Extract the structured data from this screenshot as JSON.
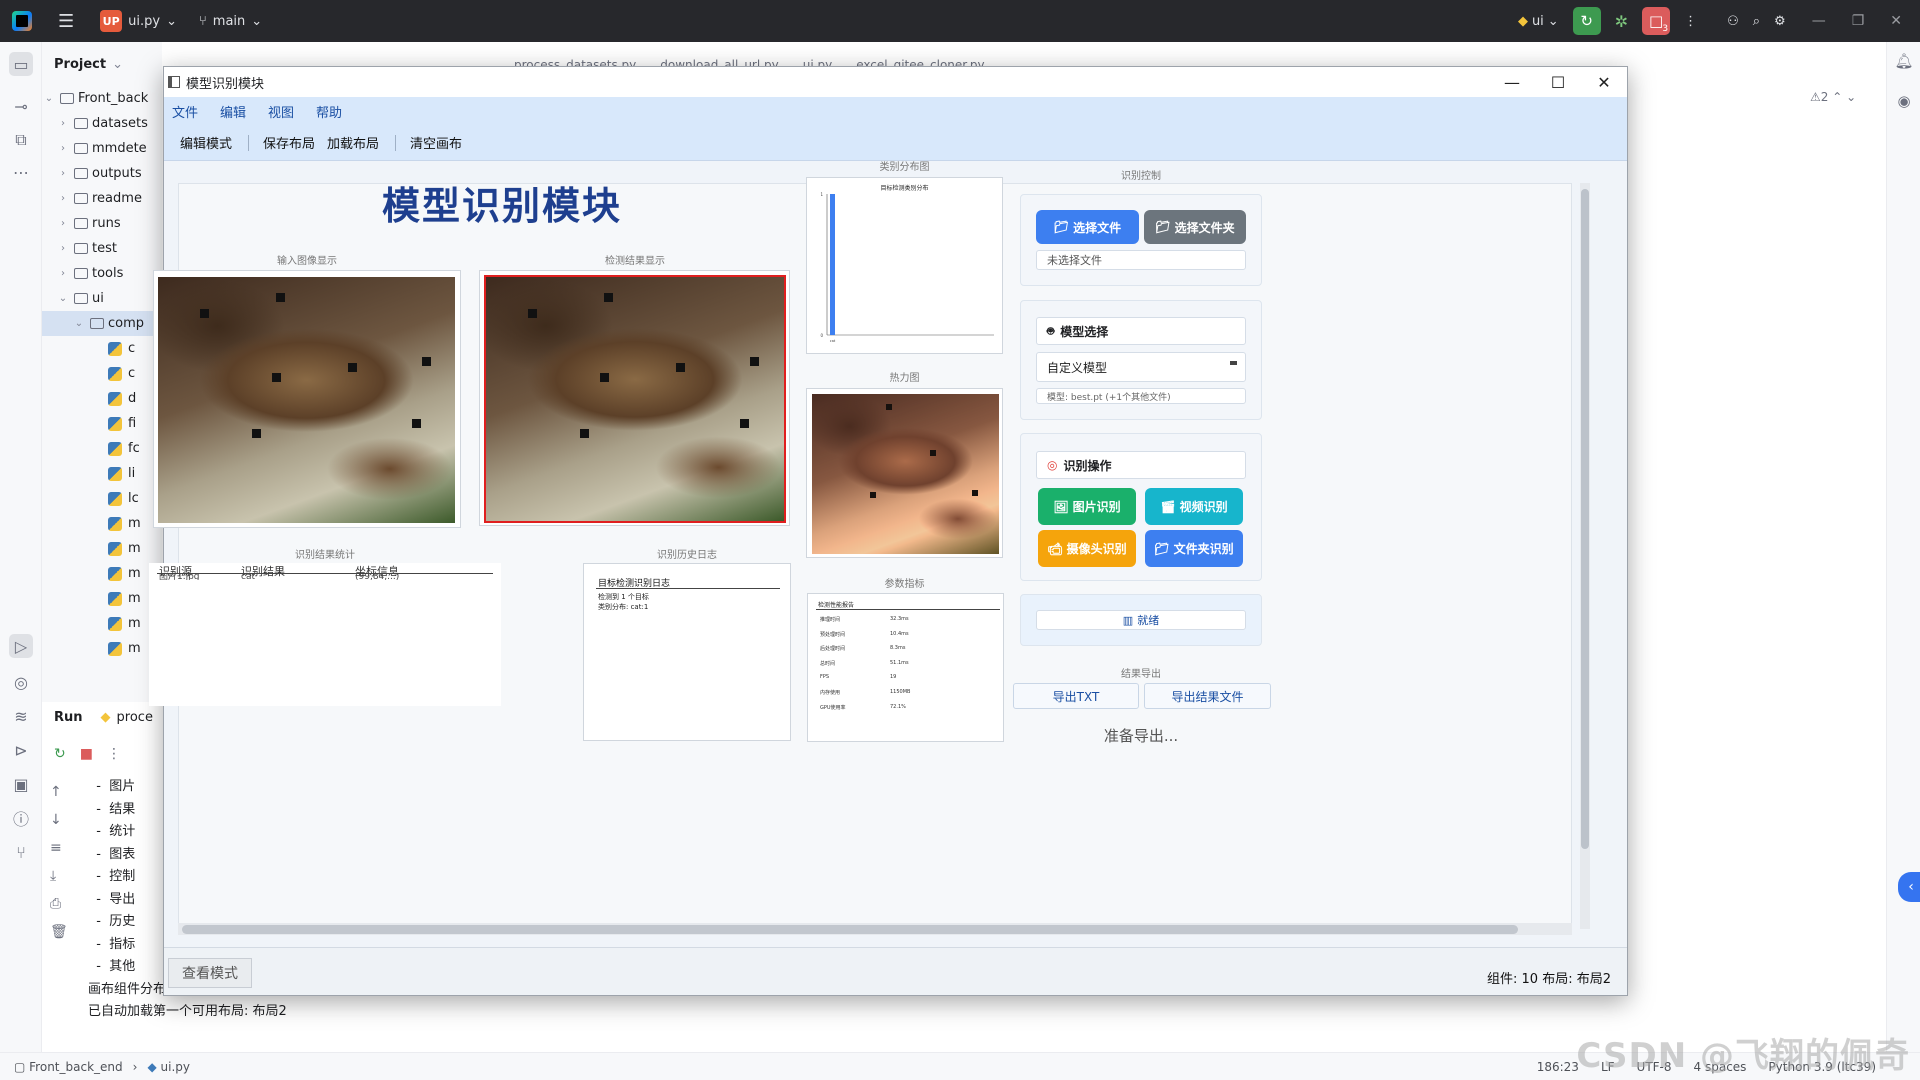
{
  "ide": {
    "project_badge": "UP",
    "project_name": "ui.py",
    "branch": "main",
    "venv": "ui",
    "project_label": "Project",
    "tree": [
      "Front_back",
      "datasets",
      "mmdete",
      "outputs",
      "readme",
      "runs",
      "test",
      "tools",
      "ui",
      "comp"
    ],
    "tree_files": [
      "c",
      "c",
      "d",
      "fi",
      "fc",
      "li",
      "lc",
      "m",
      "m",
      "m",
      "m",
      "m",
      "m"
    ],
    "editor_tabs": [
      "process_datasets.py",
      "download_all_url.py",
      "ui.py",
      "excel_gitee_cloner.py"
    ],
    "problems_count": "2",
    "run_label": "Run",
    "run_tab": "proce",
    "console_lines": [
      "  -  图片",
      "  -  结果",
      "  -  统计",
      "  -  图表",
      "  -  控制",
      "  -  导出",
      "  -  历史",
      "  -  指标",
      "  -  其他",
      "画布组件分布完成",
      "已自动加载第一个可用布局: 布局2"
    ],
    "breadcrumb": [
      "Front_back_end",
      "ui.py"
    ],
    "status": {
      "position": "186:23",
      "line_sep": "LF",
      "encoding": "UTF-8",
      "indent": "4 spaces",
      "interpreter": "Python 3.9 (ltc39)"
    },
    "watermark": "CSDN @飞翔的佩奇"
  },
  "app": {
    "window_title": "模型识别模块",
    "menu": [
      "文件",
      "编辑",
      "视图",
      "帮助"
    ],
    "toolbar": [
      "编辑模式",
      "保存布局",
      "加载布局",
      "清空画布"
    ],
    "main_title": "模型识别模块",
    "captions": {
      "input_image": "输入图像显示",
      "result_image": "检测结果显示",
      "stats": "识别结果统计",
      "history": "识别历史日志",
      "class_chart": "类别分布图",
      "heatmap": "热力图",
      "metrics": "参数指标",
      "control": "识别控制",
      "export": "结果导出"
    },
    "stats_table": {
      "headers": [
        "识别源",
        "识别结果",
        "坐标信息"
      ],
      "row": [
        "图片1.jpg",
        "cat",
        "(99,84,...)"
      ]
    },
    "history_log": {
      "title": "目标检测识别日志",
      "lines": [
        "检测到 1 个目标",
        "类别分布: cat:1"
      ]
    },
    "chart_title": "目标检测类别分布",
    "metrics_title": "检测性能报告",
    "metric_rows": [
      [
        "推理时间",
        "32.3ms"
      ],
      [
        "预处理时间",
        "10.4ms"
      ],
      [
        "后处理时间",
        "8.3ms"
      ],
      [
        "总时间",
        "51.1ms"
      ],
      [
        "FPS",
        "19"
      ],
      [
        "内存使用",
        "1150MB"
      ],
      [
        "GPU使用率",
        "72.1%"
      ]
    ],
    "buttons": {
      "select_file": "选择文件",
      "select_folder": "选择文件夹",
      "image_detect": "图片识别",
      "video_detect": "视频识别",
      "camera_detect": "摄像头识别",
      "folder_detect": "文件夹识别",
      "export_txt": "导出TXT",
      "export_results": "导出结果文件"
    },
    "file_status": "未选择文件",
    "model_section": "模型选择",
    "model_value": "自定义模型",
    "model_hint": "模型: best.pt (+1个其他文件)",
    "detect_section": "识别操作",
    "ready": "就绪",
    "export_status": "准备导出...",
    "view_mode": "查看模式",
    "status_right": "组件: 10  布局: 布局2",
    "colors": {
      "accent_blue": "#3d7ff0",
      "gray_btn": "#6c757d",
      "green_btn": "#1ab06b",
      "cyan_btn": "#17b5cc",
      "orange_btn": "#f5a40c",
      "title_blue": "#1e3f8f"
    }
  },
  "chart_data": {
    "type": "bar",
    "title": "目标检测类别分布",
    "categories": [
      "cat"
    ],
    "values": [
      1
    ],
    "ylim": [
      0,
      1
    ]
  }
}
